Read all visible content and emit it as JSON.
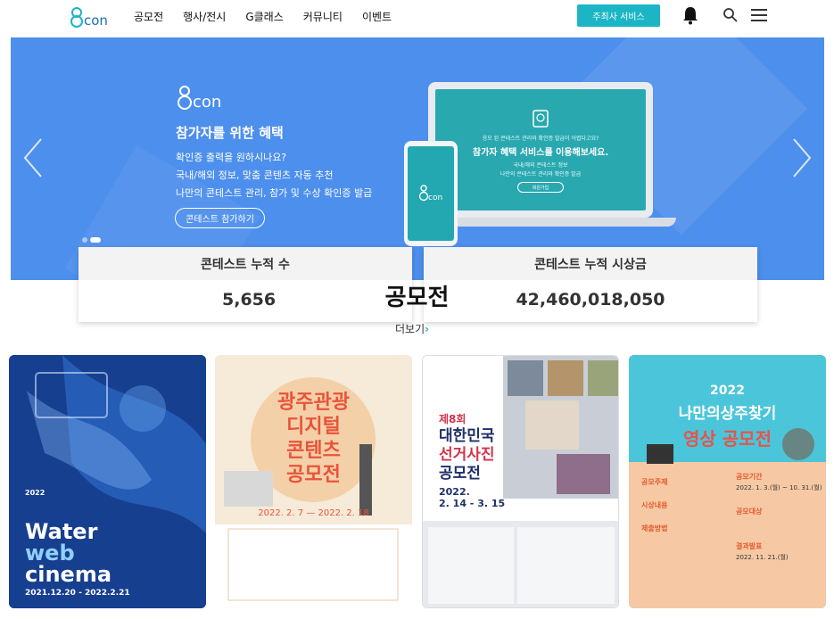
{
  "header": {
    "logo_text": "econ",
    "nav": [
      "공모전",
      "행사/전시",
      "G클래스",
      "커뮤니티",
      "이벤트"
    ],
    "host_button": "주최사 서비스",
    "icons": [
      "bell-icon",
      "search-icon",
      "menu-icon"
    ]
  },
  "banner": {
    "logo_text": "econ",
    "title": "참가자를 위한 혜택",
    "lines": [
      "확인증 출력을 원하시나요?",
      "국내/해외 정보, 맞춤 콘텐츠 자동 추천",
      "나만의 콘테스트 관리, 참가 및 수상 확인증 발급"
    ],
    "button": "콘테스트 참가하기",
    "screen_small_top": "응모 된 콘테스트 관리와 확인증 발급이 어렵다고요?",
    "screen_title": "참가자 혜택 서비스를 이용해보세요.",
    "screen_lines": [
      "국내/해외 콘테스트 정보",
      "나만의 콘테스트 관리와 확인증 발급"
    ],
    "screen_button": "회원가입",
    "colors": {
      "bg": "#4d8fec",
      "accent": "#1bb5c6"
    }
  },
  "stats": [
    {
      "label": "콘테스트 누적 수",
      "value": "5,656"
    },
    {
      "label": "콘테스트 누적 시상금",
      "value": "42,460,018,050"
    }
  ],
  "section": {
    "title": "공모전",
    "more": "더보기"
  },
  "posters": [
    {
      "year": "2022",
      "lines": [
        "Water",
        "web",
        "cinema"
      ],
      "dates": "2021.12.20 - 2022.2.21"
    },
    {
      "title_lines": [
        "광주관광",
        "디지털",
        "콘텐츠",
        "공모전"
      ],
      "dates": "2022. 2. 7 — 2022. 2. 18"
    },
    {
      "round": "제8회",
      "title_lines": [
        "대한민국",
        "선거사진",
        "공모전"
      ],
      "dates": "2022.",
      "dates2": "2. 14 - 3. 15"
    },
    {
      "year": "2022",
      "title_lines": [
        "나만의상주찾기",
        "영상 공모전"
      ],
      "fields": [
        "공모주제",
        "공모기간",
        "시상내용",
        "공모대상",
        "제출방법",
        "결과발표"
      ],
      "dates": [
        "2022. 1. 3.(월) ~ 10. 31.(월)",
        "2022. 11. 21.(월)"
      ]
    }
  ]
}
